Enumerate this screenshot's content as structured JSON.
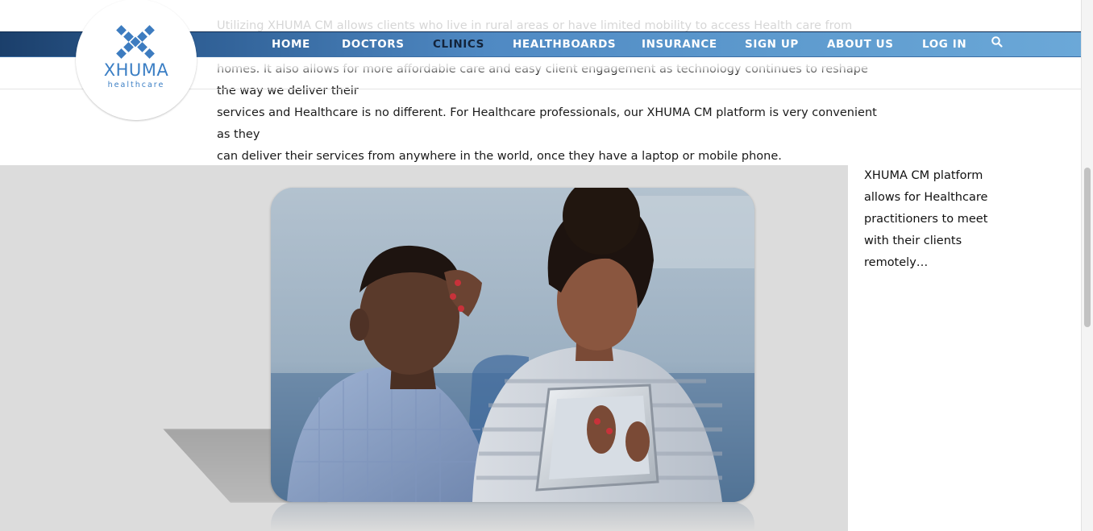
{
  "intro": {
    "lines": [
      "Utilizing XHUMA CM allows clients who live in rural areas or have limited mobility to access Health care from their",
      "homes. It also allows for more affordable care and easy client engagement as technology continues to reshape the way we deliver their",
      "services and Healthcare is no different.  For Healthcare professionals, our XHUMA CM platform is very convenient as they",
      "can deliver their services from anywhere in the world, once they have a laptop or mobile phone."
    ]
  },
  "nav": {
    "items": [
      {
        "label": "HOME"
      },
      {
        "label": "DOCTORS"
      },
      {
        "label": "CLINICS"
      },
      {
        "label": "HEALTHBOARDS"
      },
      {
        "label": "INSURANCE"
      },
      {
        "label": "SIGN UP"
      },
      {
        "label": "ABOUT US"
      },
      {
        "label": "LOG IN"
      }
    ],
    "active": "CLINICS",
    "search_icon": "search-icon",
    "colors": {
      "bar_start": "#1b3f6b",
      "bar_end": "#6ba8d8",
      "text": "#ffffff",
      "active_text": "#13233a"
    }
  },
  "logo": {
    "name": "XHUMA",
    "sub": "healthcare",
    "color": "#3a7ec4"
  },
  "figure": {
    "photo": "woman-showing-tablet-to-teenage-boy-photo"
  },
  "caption": {
    "lines": [
      "XHUMA CM platform",
      "allows for Healthcare",
      "practitioners to meet",
      "with their clients",
      "remotely…"
    ]
  }
}
